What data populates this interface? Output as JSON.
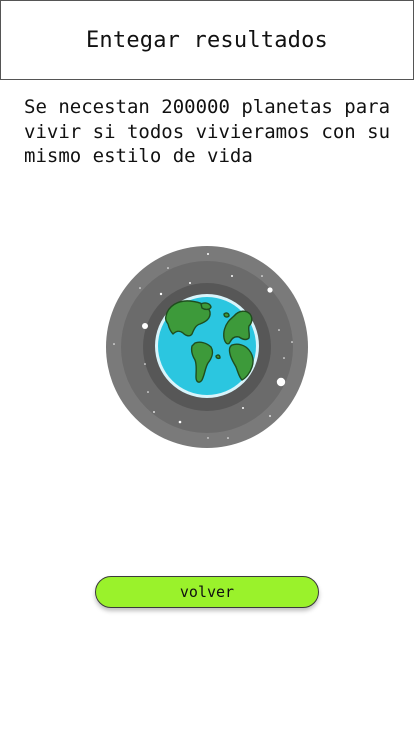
{
  "header": {
    "title": "Entegar resultados"
  },
  "result": {
    "message": "Se necestan 200000 planetas para vivir si todos vivieramos con su mismo estilo de vida"
  },
  "illustration": {
    "icon": "earth-planet-icon"
  },
  "actions": {
    "back_label": "volver"
  },
  "colors": {
    "button": "#9af22b",
    "ocean": "#2bc6e0",
    "land": "#3d9a3a",
    "space_outer": "#7a7a7a",
    "space_mid": "#6a6a6a",
    "space_inner": "#575757"
  }
}
